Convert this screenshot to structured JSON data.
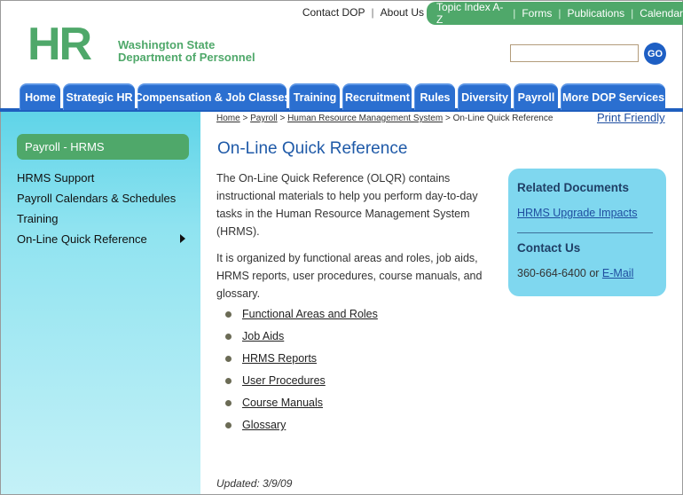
{
  "util_nav": {
    "left": [
      "Contact DOP",
      "About Us"
    ],
    "right": [
      "Topic Index A-Z",
      "Forms",
      "Publications",
      "Calendar"
    ]
  },
  "logo": {
    "mark": "HR",
    "line1": "Washington State",
    "line2": "Department of Personnel"
  },
  "search": {
    "value": "",
    "button": "GO"
  },
  "nav": [
    "Home",
    "Strategic HR",
    "Compensation & Job Classes",
    "Training",
    "Recruitment",
    "Rules",
    "Diversity",
    "Payroll",
    "More DOP Services"
  ],
  "sidebar": {
    "heading": "Payroll - HRMS",
    "items": [
      "HRMS Support",
      "Payroll Calendars & Schedules",
      "Training",
      "On-Line Quick Reference"
    ]
  },
  "breadcrumb": {
    "links": [
      "Home",
      "Payroll",
      "Human Resource Management System"
    ],
    "current": "On-Line Quick Reference",
    "sep": ">"
  },
  "print_link": "Print Friendly",
  "page_title": "On-Line Quick Reference",
  "paragraphs": [
    "The On-Line Quick Reference (OLQR) contains instructional materials to help you perform day-to-day tasks in the Human Resource Management System (HRMS).",
    "It is organized by functional areas and roles, job aids, HRMS reports, user procedures, course manuals, and glossary."
  ],
  "links": [
    "Functional Areas and Roles",
    "Job Aids",
    "HRMS Reports",
    "User Procedures",
    "Course Manuals",
    "Glossary"
  ],
  "related": {
    "heading": "Related Documents",
    "doc_link": "HRMS Upgrade Impacts",
    "contact_heading": "Contact Us",
    "phone": "360-664-6400 or",
    "email_link": "E-Mail"
  },
  "updated": "Updated: 3/9/09",
  "colors": {
    "green": "#4fa86a",
    "blue_nav": "#2b6fd0",
    "cyan": "#7fd7ef"
  }
}
